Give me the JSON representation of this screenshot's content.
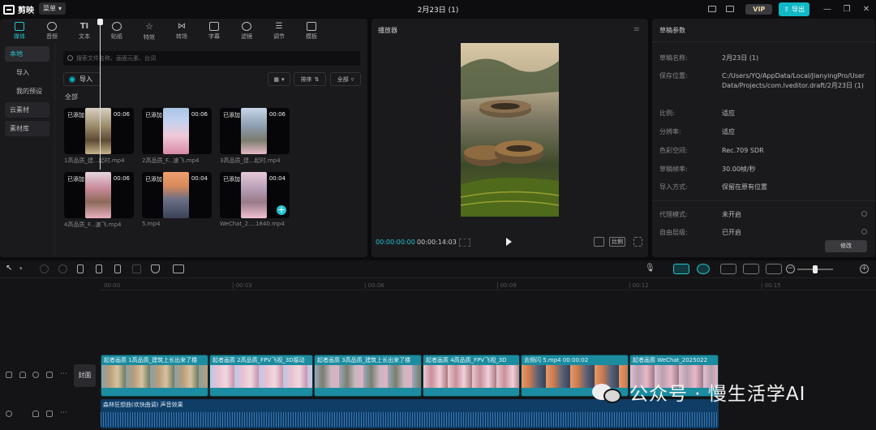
{
  "app": {
    "logo": "剪映",
    "menu": "菜单",
    "title": "2月23日 (1)",
    "vip": "VIP",
    "export": "导出"
  },
  "toolbar": [
    "媒体",
    "音频",
    "文本",
    "贴纸",
    "特效",
    "转场",
    "字幕",
    "滤镜",
    "调节",
    "模板"
  ],
  "sidebar": [
    "本地",
    "导入",
    "我的预设",
    "云素材",
    "素材库"
  ],
  "media": {
    "search_placeholder": "搜索文件名称、画面元素、台词",
    "import_label": "导入",
    "sort_label": "排序",
    "filter_label": "全部",
    "section_label": "全部",
    "clips": [
      {
        "added": "已添加",
        "duration": "00:06",
        "name": "1高品质_建...起时.mp4"
      },
      {
        "added": "已添加",
        "duration": "00:06",
        "name": "2高品质_F...速飞.mp4"
      },
      {
        "added": "已添加",
        "duration": "00:06",
        "name": "3高品质_建...起时.mp4"
      },
      {
        "added": "已添加",
        "duration": "00:06",
        "name": "4高品质_F...速飞.mp4"
      },
      {
        "added": "已添加",
        "duration": "00:04",
        "name": "5.mp4"
      },
      {
        "added": "已添加",
        "duration": "00:04",
        "name": "WeChat_2....1840.mp4"
      }
    ]
  },
  "player": {
    "title": "播放器",
    "current_time": "00:00:00:00",
    "total_time": "00:00:14:03",
    "ratio_label": "比例"
  },
  "draft": {
    "title": "草稿参数",
    "rows": [
      {
        "label": "草稿名称:",
        "value": "2月23日 (1)"
      },
      {
        "label": "保存位置:",
        "value": "C:/Users/YQ/AppData/Local/JianyingPro/User Data/Projects/com.lveditor.draft/2月23日 (1)"
      },
      {
        "label": "比例:",
        "value": "适应"
      },
      {
        "label": "分辨率:",
        "value": "适应"
      },
      {
        "label": "色彩空间:",
        "value": "Rec.709 SDR"
      },
      {
        "label": "草稿帧率:",
        "value": "30.00帧/秒"
      },
      {
        "label": "导入方式:",
        "value": "保留在原有位置"
      },
      {
        "label": "代理模式:",
        "value": "未开启"
      },
      {
        "label": "自由层级:",
        "value": "已开启"
      }
    ],
    "modify": "修改"
  },
  "timeline": {
    "ticks": [
      "00:00",
      "| 00:03",
      "| 00:06",
      "| 00:09",
      "| 00:12",
      "| 00:15"
    ],
    "cover": "封面",
    "video_clips": [
      "起者画质  1高品质_建筑上长出来了楼",
      "起者画质  2高品质_FPV飞视_3D振动",
      "起者画质  3高品质_建筑上长出来了楼",
      "起者画质  4高品质_FPV飞视_3D",
      "去频闪  5.mp4  00:00:02",
      "起者画质  WeChat_2025022"
    ],
    "audio_label": "森林狂想曲(欢快曲调)  声音效果"
  },
  "watermark": "公众号 · 慢生活学AI"
}
